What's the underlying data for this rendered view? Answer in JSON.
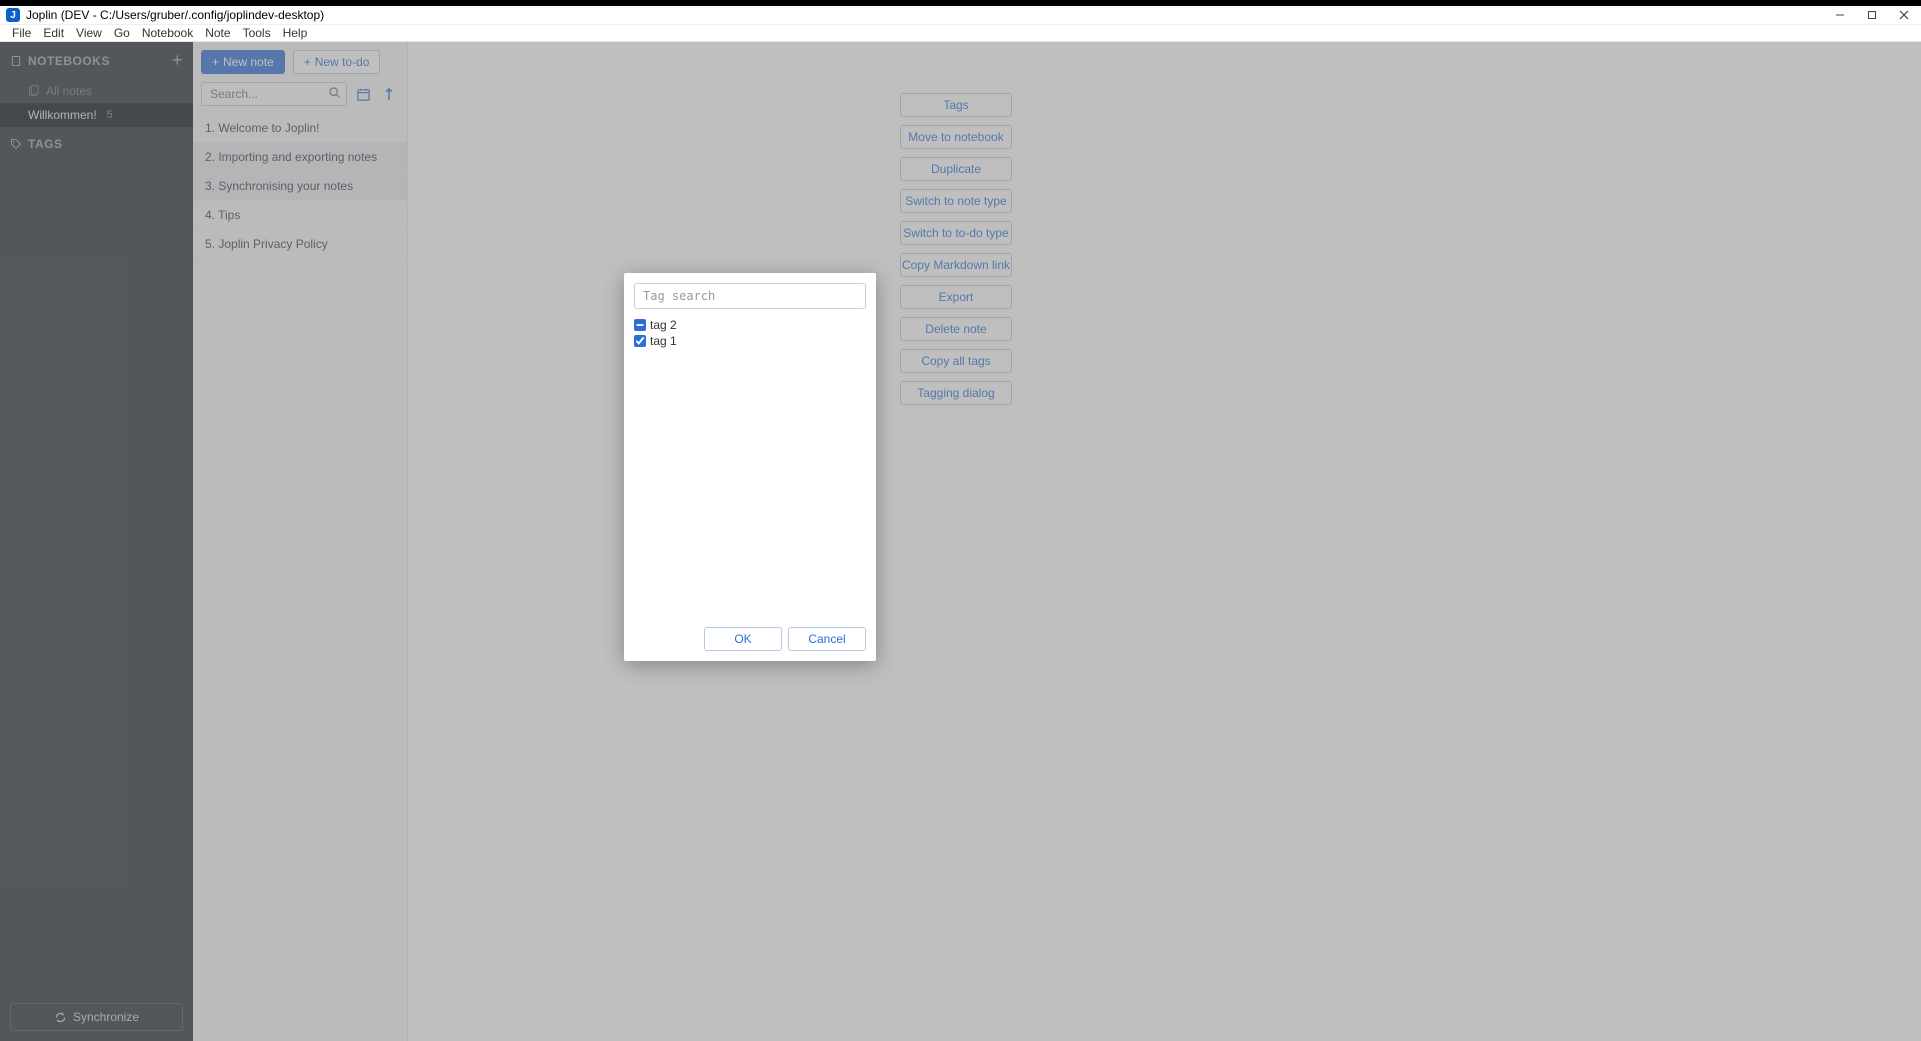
{
  "titlebar": {
    "app_initial": "J",
    "title": "Joplin (DEV - C:/Users/gruber/.config/joplindev-desktop)"
  },
  "menubar": [
    "File",
    "Edit",
    "View",
    "Go",
    "Notebook",
    "Note",
    "Tools",
    "Help"
  ],
  "sidebar": {
    "notebooks_label": "NOTEBOOKS",
    "all_notes": "All notes",
    "notebook_name": "Willkommen!",
    "notebook_count": "5",
    "tags_label": "TAGS",
    "sync_label": "Synchronize"
  },
  "notelist": {
    "new_note": "New note",
    "new_todo": "New to-do",
    "search_placeholder": "Search...",
    "items": [
      "1. Welcome to Joplin!",
      "2. Importing and exporting notes",
      "3. Synchronising your notes",
      "4. Tips",
      "5. Joplin Privacy Policy"
    ]
  },
  "context_menu": [
    "Tags",
    "Move to notebook",
    "Duplicate",
    "Switch to note type",
    "Switch to to-do type",
    "Copy Markdown link",
    "Export",
    "Delete note",
    "Copy all tags",
    "Tagging dialog"
  ],
  "dialog": {
    "search_placeholder": "Tag search",
    "tags": [
      {
        "label": "tag 2",
        "checked": false,
        "indeterminate": true
      },
      {
        "label": "tag 1",
        "checked": true,
        "indeterminate": false
      }
    ],
    "ok": "OK",
    "cancel": "Cancel"
  }
}
